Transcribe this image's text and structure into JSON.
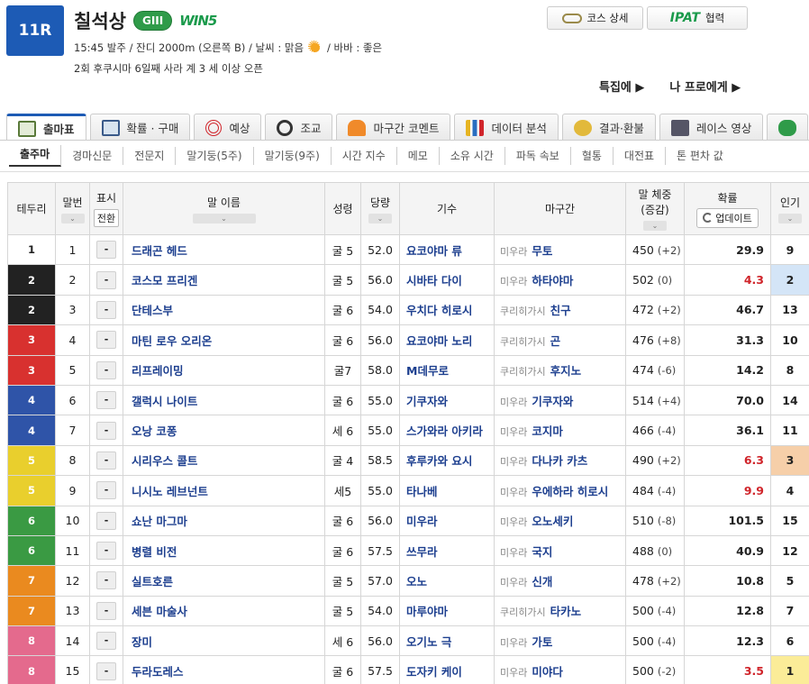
{
  "header": {
    "race_no": "11R",
    "race_name": "칠석상",
    "grade": "GIII",
    "win5": "WIN5",
    "info_line1": "15:45 발주 / 잔디 2000m (오른쪽 B) / 날씨 : 맑음",
    "info_line1_tail": "/ 바바 : 좋은",
    "info_line2": "2회 후쿠시마 6일째 사라 계 3 세 이상 오픈",
    "weather_icon": "sun-icon",
    "course_btn": "코스 상세",
    "ipat_logo": "IPAT",
    "ipat_label": "협력",
    "link1": "특집에 ▶",
    "link2": "나 프로에게 ▶"
  },
  "tabs": [
    "출마표",
    "확률 · 구매",
    "예상",
    "조교",
    "마구간 코멘트",
    "데이터 분석",
    "결과·환불",
    "레이스 영상"
  ],
  "subtabs": [
    "출주마",
    "경마신문",
    "전문지",
    "말기둥(5주)",
    "말기둥(9주)",
    "시간 지수",
    "메모",
    "소유 시간",
    "파독 속보",
    "혈통",
    "대전표",
    "톤 편차 값"
  ],
  "columns": {
    "waku": "테두리",
    "umaban": "말번",
    "mark": "표시",
    "mark_btn": "전환",
    "horse": "말 이름",
    "sex_age": "성령",
    "weight": "당량",
    "jockey": "기수",
    "trainer": "마구간",
    "body_weight": "말 체중",
    "body_weight_sub": "(증감)",
    "odds": "확률",
    "update": "업데이트",
    "popularity": "인기",
    "sort_icon": "⌄"
  },
  "colors": {
    "waku": {
      "1": "#ffffff",
      "2": "#222222",
      "3": "#d8312f",
      "4": "#2f54a8",
      "5": "#e9cf2d",
      "6": "#3a9a43",
      "7": "#ea8a1f",
      "8": "#e46a8d"
    },
    "pop1": "#fbec98",
    "pop2": "#d4e5f7",
    "pop3": "#f6cfa9"
  },
  "rows": [
    {
      "waku": "1",
      "num": "1",
      "mark": "-",
      "horse": "드래곤 헤드",
      "sex": "굴 5",
      "weight": "52.0",
      "jockey": "요코야마 류",
      "region": "미우라",
      "trainer": "무토",
      "bw": "450",
      "diff": "(+2)",
      "odds": "29.9",
      "red": false,
      "pop": "9"
    },
    {
      "waku": "2",
      "num": "2",
      "mark": "-",
      "horse": "코스모 프리겐",
      "sex": "굴 5",
      "weight": "56.0",
      "jockey": "시바타 다이",
      "region": "미우라",
      "trainer": "하타야마",
      "bw": "502",
      "diff": "(0)",
      "odds": "4.3",
      "red": true,
      "pop": "2"
    },
    {
      "waku": "2",
      "num": "3",
      "mark": "-",
      "horse": "단테스부",
      "sex": "굴 6",
      "weight": "54.0",
      "jockey": "우치다 히로시",
      "region": "쿠리히가시",
      "trainer": "친구",
      "bw": "472",
      "diff": "(+2)",
      "odds": "46.7",
      "red": false,
      "pop": "13"
    },
    {
      "waku": "3",
      "num": "4",
      "mark": "-",
      "horse": "마틴 로우 오리온",
      "sex": "굴 6",
      "weight": "56.0",
      "jockey": "요코야마 노리",
      "region": "쿠리히가시",
      "trainer": "곤",
      "bw": "476",
      "diff": "(+8)",
      "odds": "31.3",
      "red": false,
      "pop": "10"
    },
    {
      "waku": "3",
      "num": "5",
      "mark": "-",
      "horse": "리프레이밍",
      "sex": "굴7",
      "weight": "58.0",
      "jockey": "M데무로",
      "region": "쿠리히가시",
      "trainer": "후지노",
      "bw": "474",
      "diff": "(-6)",
      "odds": "14.2",
      "red": false,
      "pop": "8"
    },
    {
      "waku": "4",
      "num": "6",
      "mark": "-",
      "horse": "갤럭시 나이트",
      "sex": "굴 6",
      "weight": "55.0",
      "jockey": "기쿠자와",
      "region": "미우라",
      "trainer": "기쿠자와",
      "bw": "514",
      "diff": "(+4)",
      "odds": "70.0",
      "red": false,
      "pop": "14"
    },
    {
      "waku": "4",
      "num": "7",
      "mark": "-",
      "horse": "오낭 코퐁",
      "sex": "세 6",
      "weight": "55.0",
      "jockey": "스가와라 아키라",
      "region": "미우라",
      "trainer": "코지마",
      "bw": "466",
      "diff": "(-4)",
      "odds": "36.1",
      "red": false,
      "pop": "11"
    },
    {
      "waku": "5",
      "num": "8",
      "mark": "-",
      "horse": "시리우스 콜트",
      "sex": "굴 4",
      "weight": "58.5",
      "jockey": "후루카와 요시",
      "region": "미우라",
      "trainer": "다나카 카츠",
      "bw": "490",
      "diff": "(+2)",
      "odds": "6.3",
      "red": true,
      "pop": "3"
    },
    {
      "waku": "5",
      "num": "9",
      "mark": "-",
      "horse": "니시노 레브넌트",
      "sex": "세5",
      "weight": "55.0",
      "jockey": "타나베",
      "region": "미우라",
      "trainer": "우에하라 히로시",
      "bw": "484",
      "diff": "(-4)",
      "odds": "9.9",
      "red": true,
      "pop": "4"
    },
    {
      "waku": "6",
      "num": "10",
      "mark": "-",
      "horse": "쇼난 마그마",
      "sex": "굴 6",
      "weight": "56.0",
      "jockey": "미우라",
      "region": "미우라",
      "trainer": "오노세키",
      "bw": "510",
      "diff": "(-8)",
      "odds": "101.5",
      "red": false,
      "pop": "15"
    },
    {
      "waku": "6",
      "num": "11",
      "mark": "-",
      "horse": "병렬 비전",
      "sex": "굴 6",
      "weight": "57.5",
      "jockey": "쓰무라",
      "region": "미우라",
      "trainer": "국지",
      "bw": "488",
      "diff": "(0)",
      "odds": "40.9",
      "red": false,
      "pop": "12"
    },
    {
      "waku": "7",
      "num": "12",
      "mark": "-",
      "horse": "실트호른",
      "sex": "굴 5",
      "weight": "57.0",
      "jockey": "오노",
      "region": "미우라",
      "trainer": "신개",
      "bw": "478",
      "diff": "(+2)",
      "odds": "10.8",
      "red": false,
      "pop": "5"
    },
    {
      "waku": "7",
      "num": "13",
      "mark": "-",
      "horse": "세븐 마술사",
      "sex": "굴 5",
      "weight": "54.0",
      "jockey": "마루야마",
      "region": "쿠리히가시",
      "trainer": "타카노",
      "bw": "500",
      "diff": "(-4)",
      "odds": "12.8",
      "red": false,
      "pop": "7"
    },
    {
      "waku": "8",
      "num": "14",
      "mark": "-",
      "horse": "장미",
      "sex": "세 6",
      "weight": "56.0",
      "jockey": "오기노 극",
      "region": "미우라",
      "trainer": "가토",
      "bw": "500",
      "diff": "(-4)",
      "odds": "12.3",
      "red": false,
      "pop": "6"
    },
    {
      "waku": "8",
      "num": "15",
      "mark": "-",
      "horse": "두라도레스",
      "sex": "굴 6",
      "weight": "57.5",
      "jockey": "도자키 케이",
      "region": "미우라",
      "trainer": "미야다",
      "bw": "500",
      "diff": "(-2)",
      "odds": "3.5",
      "red": true,
      "pop": "1"
    }
  ]
}
